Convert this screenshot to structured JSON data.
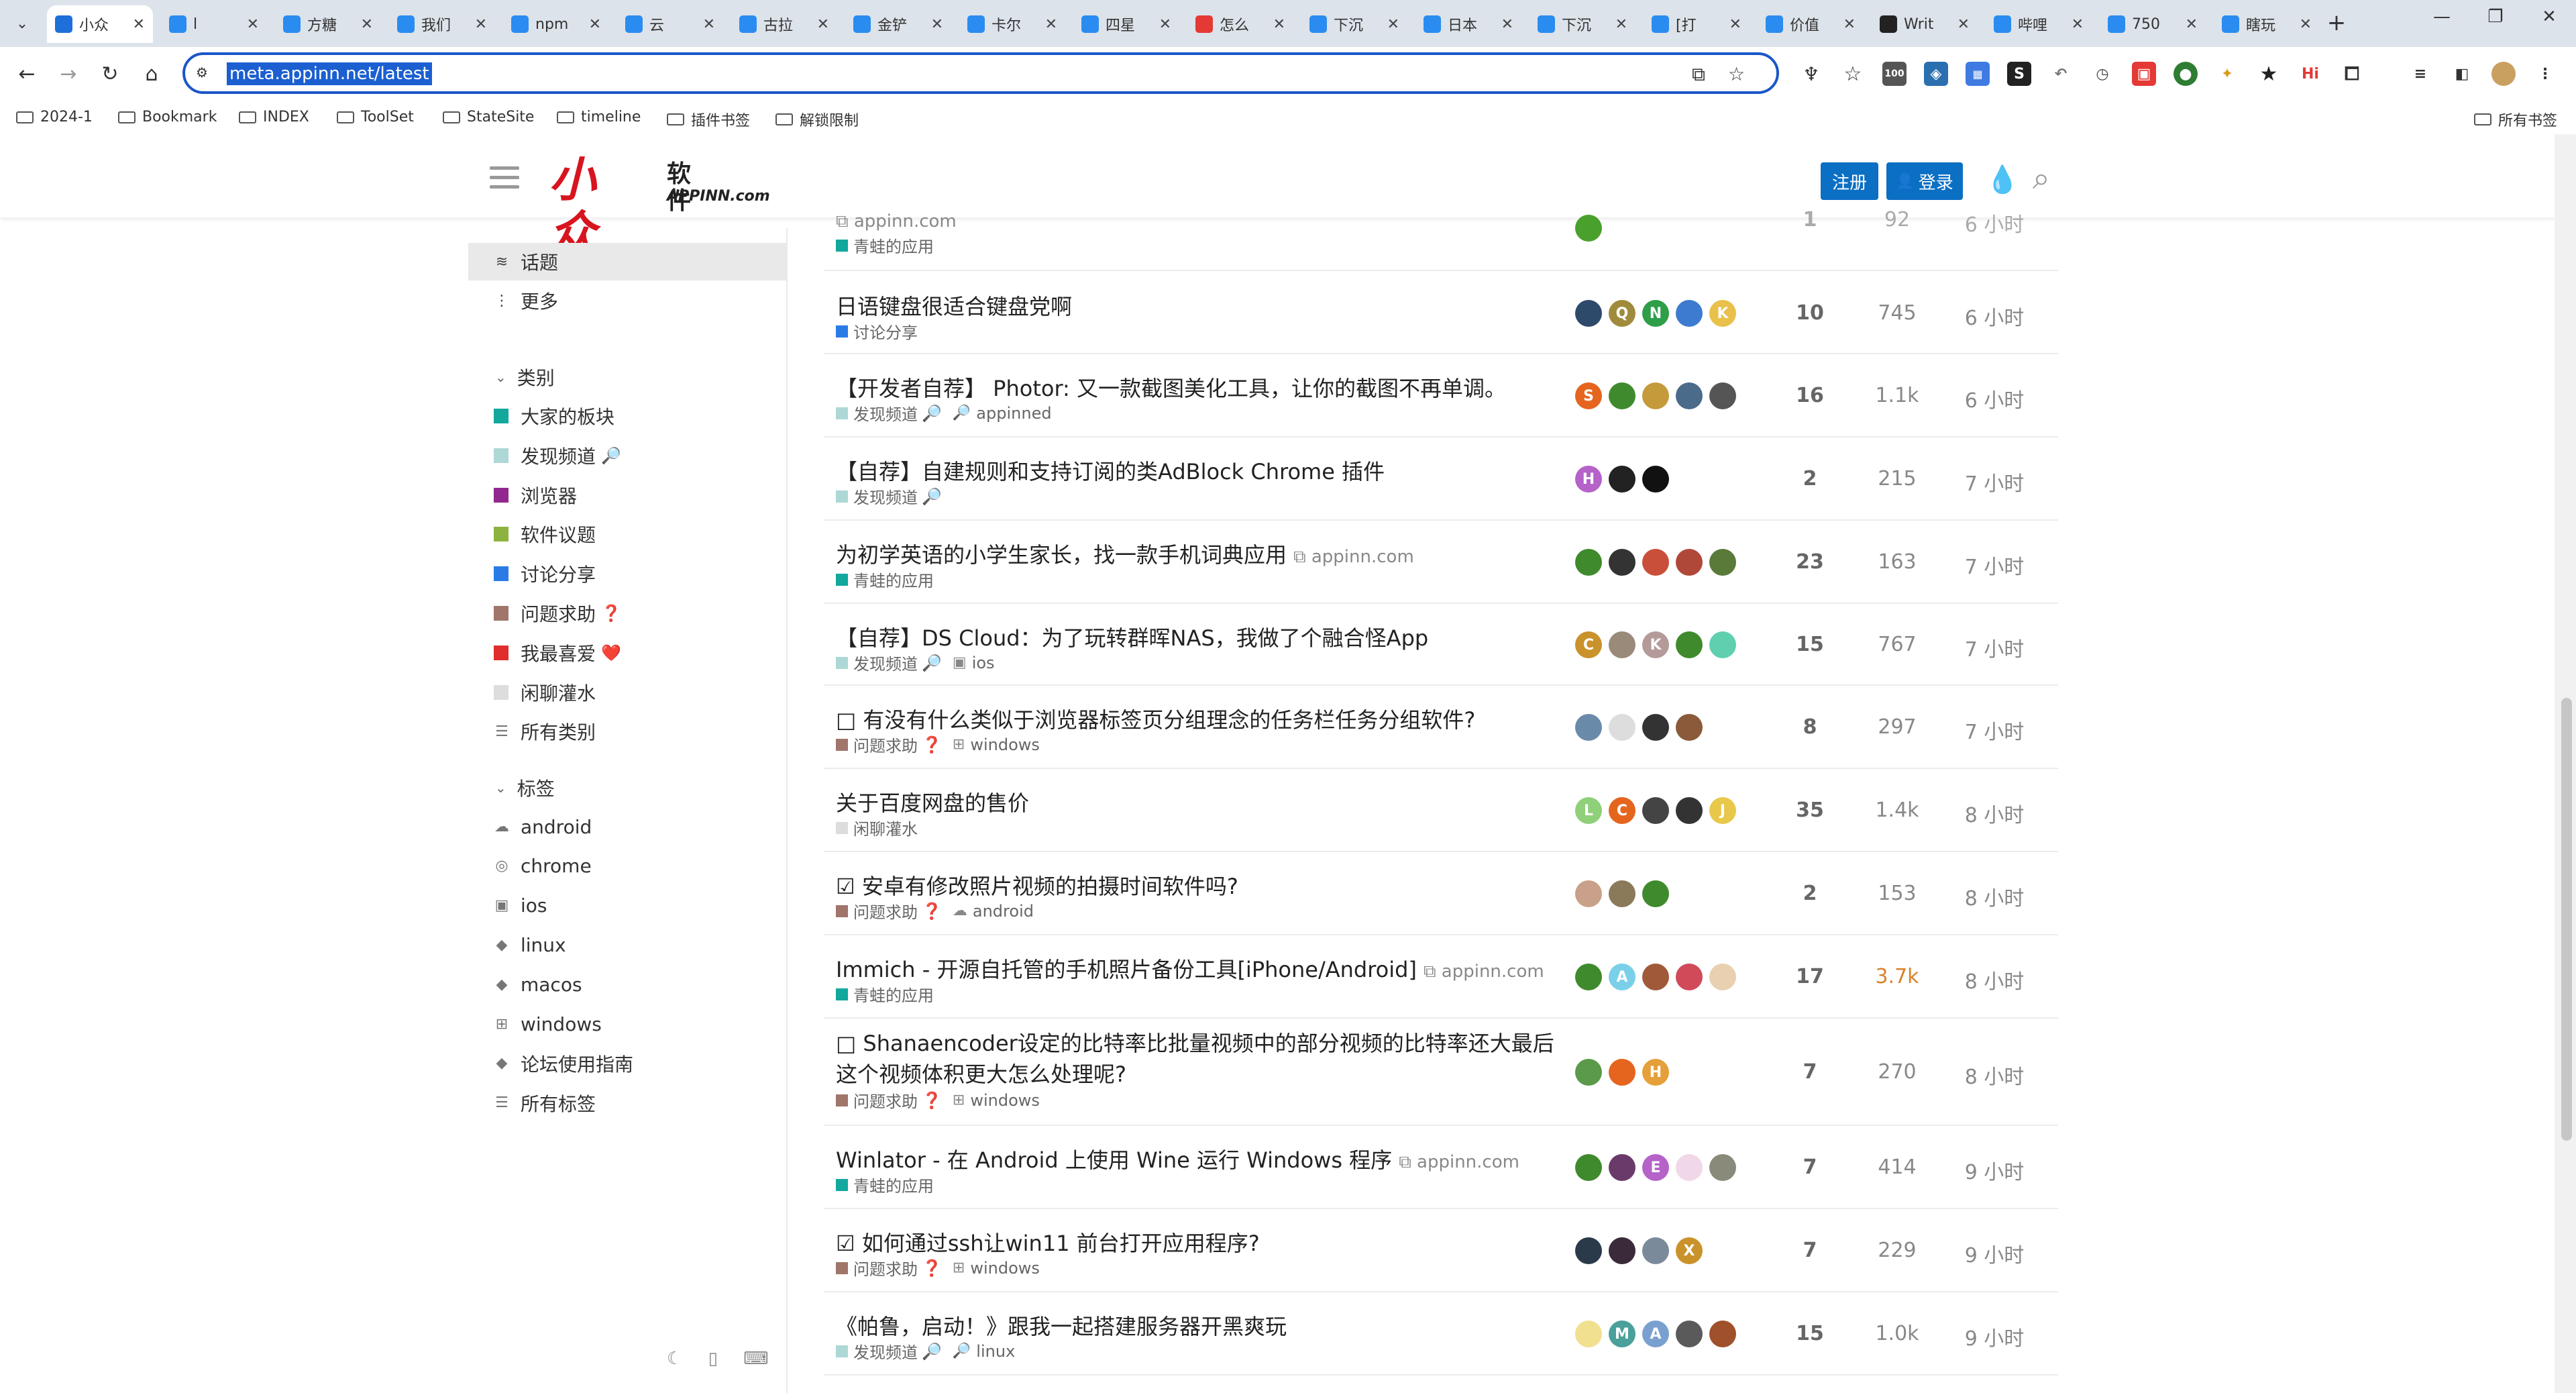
{
  "browser": {
    "tabs": [
      {
        "label": "小众",
        "icon": "water-drop",
        "color": "#1e6fd9",
        "active": true
      },
      {
        "label": "l",
        "icon": "diamond",
        "color": "#2a8cf0"
      },
      {
        "label": "方糖",
        "icon": "bird",
        "color": "#2a8cf0"
      },
      {
        "label": "我们",
        "icon": "cloud-book",
        "color": "#2a8cf0"
      },
      {
        "label": "npm",
        "icon": "cloud-book",
        "color": "#2a8cf0"
      },
      {
        "label": "云",
        "icon": "cloud-book",
        "color": "#2a8cf0"
      },
      {
        "label": "古拉",
        "icon": "cloud-book",
        "color": "#2a8cf0"
      },
      {
        "label": "金铲",
        "icon": "cloud-book",
        "color": "#2a8cf0"
      },
      {
        "label": "卡尔",
        "icon": "cloud-book",
        "color": "#2a8cf0"
      },
      {
        "label": "四星",
        "icon": "cloud-book",
        "color": "#2a8cf0"
      },
      {
        "label": "怎么",
        "icon": "red-logo",
        "color": "#e53935"
      },
      {
        "label": "下沉",
        "icon": "cloud-book",
        "color": "#2a8cf0"
      },
      {
        "label": "日本",
        "icon": "cloud-book",
        "color": "#2a8cf0"
      },
      {
        "label": "下沉",
        "icon": "cloud-book",
        "color": "#2a8cf0"
      },
      {
        "label": "[打",
        "icon": "cloud-book",
        "color": "#2a8cf0"
      },
      {
        "label": "价值",
        "icon": "cloud-book",
        "color": "#2a8cf0"
      },
      {
        "label": "Writ",
        "icon": "notion",
        "color": "#222222"
      },
      {
        "label": "哔哩",
        "icon": "cloud-book",
        "color": "#2a8cf0"
      },
      {
        "label": "750",
        "icon": "cloud-book",
        "color": "#2a8cf0"
      },
      {
        "label": "瞎玩",
        "icon": "cloud-book",
        "color": "#2a8cf0"
      }
    ],
    "url": "meta.appinn.net/latest",
    "bookmarks": [
      "2024-1",
      "Bookmark",
      "INDEX",
      "ToolSet",
      "StateSite",
      "timeline",
      "插件书签",
      "解锁限制"
    ],
    "all_bookmarks_label": "所有书签",
    "ext_badge": "100",
    "ext_hi": "Hi"
  },
  "site": {
    "logo_big": "小众",
    "logo_small": "软件",
    "logo_en": "APPINN.com",
    "signup_label": "注册",
    "login_label": "登录"
  },
  "sidebar": {
    "nav": [
      {
        "label": "话题",
        "icon": "layers-icon",
        "active": true
      },
      {
        "label": "更多",
        "icon": "vertical-dots-icon"
      }
    ],
    "categories_header": "类别",
    "categories": [
      {
        "label": "大家的板块",
        "color": "#12A89D",
        "emoji": ""
      },
      {
        "label": "发现频道",
        "color": "#ADD8D5",
        "emoji": "🔎"
      },
      {
        "label": "浏览器",
        "color": "#92278F",
        "emoji": ""
      },
      {
        "label": "软件议题",
        "color": "#8CB33F",
        "emoji": ""
      },
      {
        "label": "讨论分享",
        "color": "#2B7BE6",
        "emoji": ""
      },
      {
        "label": "问题求助",
        "color": "#A0766A",
        "emoji": "❓"
      },
      {
        "label": "我最喜爱",
        "color": "#E02D2D",
        "emoji": "❤️"
      },
      {
        "label": "闲聊灌水",
        "color": "#DDDDDD",
        "emoji": ""
      },
      {
        "label": "所有类别",
        "color": "",
        "emoji": ""
      }
    ],
    "tags_header": "标签",
    "tags": [
      {
        "label": "android",
        "icon": "android-icon"
      },
      {
        "label": "chrome",
        "icon": "chrome-icon"
      },
      {
        "label": "ios",
        "icon": "ios-icon"
      },
      {
        "label": "linux",
        "icon": "tag-icon"
      },
      {
        "label": "macos",
        "icon": "apple-icon"
      },
      {
        "label": "windows",
        "icon": "windows-icon"
      },
      {
        "label": "论坛使用指南",
        "icon": "tag-icon"
      },
      {
        "label": "所有标签",
        "icon": "list-icon"
      }
    ]
  },
  "topics": [
    {
      "title": "",
      "link": "appinn.com",
      "category": "青蛙的应用",
      "cat_color": "#12A89D",
      "cat_emoji": "",
      "tags": [],
      "replies": "1",
      "views": "92",
      "activity": "6 小时",
      "avatars": [
        {
          "t": "",
          "c": "#4aa02c"
        }
      ]
    },
    {
      "title": "日语键盘很适合键盘党啊",
      "link": "",
      "category": "讨论分享",
      "cat_color": "#2B7BE6",
      "cat_emoji": "",
      "tags": [],
      "replies": "10",
      "views": "745",
      "activity": "6 小时",
      "avatars": [
        {
          "t": "",
          "c": "#2d4a6b"
        },
        {
          "t": "Q",
          "c": "#a08b3c"
        },
        {
          "t": "N",
          "c": "#2e9e48"
        },
        {
          "t": "",
          "c": "#3c7bd0"
        },
        {
          "t": "K",
          "c": "#e8c04a"
        }
      ]
    },
    {
      "title": "【开发者自荐】 Photor: 又一款截图美化工具，让你的截图不再单调。",
      "link": "",
      "category": "发现频道",
      "cat_color": "#ADD8D5",
      "cat_emoji": "🔎",
      "tags": [
        "appinned"
      ],
      "replies": "16",
      "views": "1.1k",
      "activity": "6 小时",
      "avatars": [
        {
          "t": "S",
          "c": "#e5651f"
        },
        {
          "t": "",
          "c": "#3f8a2c"
        },
        {
          "t": "",
          "c": "#c49a3a"
        },
        {
          "t": "",
          "c": "#4a6b8a"
        },
        {
          "t": "",
          "c": "#555555"
        }
      ]
    },
    {
      "title": "【自荐】自建规则和支持订阅的类AdBlock Chrome 插件",
      "link": "",
      "category": "发现频道",
      "cat_color": "#ADD8D5",
      "cat_emoji": "🔎",
      "tags": [],
      "replies": "2",
      "views": "215",
      "activity": "7 小时",
      "avatars": [
        {
          "t": "H",
          "c": "#b562c9"
        },
        {
          "t": "",
          "c": "#222222"
        },
        {
          "t": "",
          "c": "#111111"
        }
      ]
    },
    {
      "title": "为初学英语的小学生家长，找一款手机词典应用",
      "link": "appinn.com",
      "category": "青蛙的应用",
      "cat_color": "#12A89D",
      "cat_emoji": "",
      "tags": [],
      "replies": "23",
      "views": "163",
      "activity": "7 小时",
      "avatars": [
        {
          "t": "",
          "c": "#3f8a2c"
        },
        {
          "t": "",
          "c": "#333333"
        },
        {
          "t": "",
          "c": "#c94f3a"
        },
        {
          "t": "",
          "c": "#b0483a"
        },
        {
          "t": "",
          "c": "#5a7a3a"
        }
      ]
    },
    {
      "title": "【自荐】DS Cloud：为了玩转群晖NAS，我做了个融合怪App",
      "link": "",
      "category": "发现频道",
      "cat_color": "#ADD8D5",
      "cat_emoji": "🔎",
      "tags": [
        "ios"
      ],
      "replies": "15",
      "views": "767",
      "activity": "7 小时",
      "avatars": [
        {
          "t": "C",
          "c": "#c9922a"
        },
        {
          "t": "",
          "c": "#9a8a7a"
        },
        {
          "t": "K",
          "c": "#b59a9a"
        },
        {
          "t": "",
          "c": "#3f8a2c"
        },
        {
          "t": "",
          "c": "#5fcfb0"
        }
      ]
    },
    {
      "title": "□ 有没有什么类似于浏览器标签页分组理念的任务栏任务分组软件?",
      "link": "",
      "category": "问题求助",
      "cat_color": "#A0766A",
      "cat_emoji": "❓",
      "tags": [
        "windows"
      ],
      "replies": "8",
      "views": "297",
      "activity": "7 小时",
      "avatars": [
        {
          "t": "",
          "c": "#6a8aaa"
        },
        {
          "t": "",
          "c": "#dddddd"
        },
        {
          "t": "",
          "c": "#333333"
        },
        {
          "t": "",
          "c": "#8a5a3a"
        }
      ]
    },
    {
      "title": "关于百度网盘的售价",
      "link": "",
      "category": "闲聊灌水",
      "cat_color": "#DDDDDD",
      "cat_emoji": "",
      "tags": [],
      "replies": "35",
      "views": "1.4k",
      "activity": "8 小时",
      "avatars": [
        {
          "t": "L",
          "c": "#8fd07a"
        },
        {
          "t": "C",
          "c": "#e5651f"
        },
        {
          "t": "",
          "c": "#444444"
        },
        {
          "t": "",
          "c": "#333333"
        },
        {
          "t": "J",
          "c": "#e8c84a"
        }
      ]
    },
    {
      "title": "☑ 安卓有修改照片视频的拍摄时间软件吗?",
      "link": "",
      "category": "问题求助",
      "cat_color": "#A0766A",
      "cat_emoji": "❓",
      "tags": [
        "android"
      ],
      "replies": "2",
      "views": "153",
      "activity": "8 小时",
      "avatars": [
        {
          "t": "",
          "c": "#c9a08a"
        },
        {
          "t": "",
          "c": "#8a7a5a"
        },
        {
          "t": "",
          "c": "#3f8a2c"
        }
      ]
    },
    {
      "title": "Immich - 开源自托管的手机照片备份工具[iPhone/Android]",
      "link": "appinn.com",
      "category": "青蛙的应用",
      "cat_color": "#12A89D",
      "cat_emoji": "",
      "tags": [],
      "replies": "17",
      "views": "3.7k",
      "views_hot": true,
      "activity": "8 小时",
      "avatars": [
        {
          "t": "",
          "c": "#3f8a2c"
        },
        {
          "t": "A",
          "c": "#7ad0e8"
        },
        {
          "t": "",
          "c": "#a05a3a"
        },
        {
          "t": "",
          "c": "#d04a5a"
        },
        {
          "t": "",
          "c": "#e8d0b0"
        }
      ]
    },
    {
      "title": "□ Shanaencoder设定的比特率比批量视频中的部分视频的比特率还大最后这个视频体积更大怎么处理呢?",
      "link": "",
      "category": "问题求助",
      "cat_color": "#A0766A",
      "cat_emoji": "❓",
      "tags": [
        "windows"
      ],
      "replies": "7",
      "views": "270",
      "activity": "8 小时",
      "wrap": true,
      "avatars": [
        {
          "t": "",
          "c": "#5a9a4a"
        },
        {
          "t": "",
          "c": "#e5651f"
        },
        {
          "t": "H",
          "c": "#e5a03a"
        }
      ]
    },
    {
      "title": "Winlator - 在 Android 上使用 Wine 运行 Windows 程序",
      "link": "appinn.com",
      "category": "青蛙的应用",
      "cat_color": "#12A89D",
      "cat_emoji": "",
      "tags": [],
      "replies": "7",
      "views": "414",
      "activity": "9 小时",
      "avatars": [
        {
          "t": "",
          "c": "#3f8a2c"
        },
        {
          "t": "",
          "c": "#6a3a6a"
        },
        {
          "t": "E",
          "c": "#b562c9"
        },
        {
          "t": "",
          "c": "#f0d8e8"
        },
        {
          "t": "",
          "c": "#8a8a7a"
        }
      ]
    },
    {
      "title": "☑ 如何通过ssh让win11 前台打开应用程序?",
      "link": "",
      "category": "问题求助",
      "cat_color": "#A0766A",
      "cat_emoji": "❓",
      "tags": [
        "windows"
      ],
      "replies": "7",
      "views": "229",
      "activity": "9 小时",
      "avatars": [
        {
          "t": "",
          "c": "#2a3a4a"
        },
        {
          "t": "",
          "c": "#3a2a3a"
        },
        {
          "t": "",
          "c": "#7a8a9a"
        },
        {
          "t": "X",
          "c": "#c9922a"
        }
      ]
    },
    {
      "title": "《帕鲁，启动！》跟我一起搭建服务器开黑爽玩",
      "link": "",
      "category": "发现频道",
      "cat_color": "#ADD8D5",
      "cat_emoji": "🔎",
      "tags": [
        "linux"
      ],
      "replies": "15",
      "views": "1.0k",
      "activity": "9 小时",
      "avatars": [
        {
          "t": "",
          "c": "#f0e090"
        },
        {
          "t": "M",
          "c": "#4aa09a"
        },
        {
          "t": "A",
          "c": "#7aa0d0"
        },
        {
          "t": "",
          "c": "#5a5a5a"
        },
        {
          "t": "",
          "c": "#a0502a"
        }
      ]
    }
  ]
}
